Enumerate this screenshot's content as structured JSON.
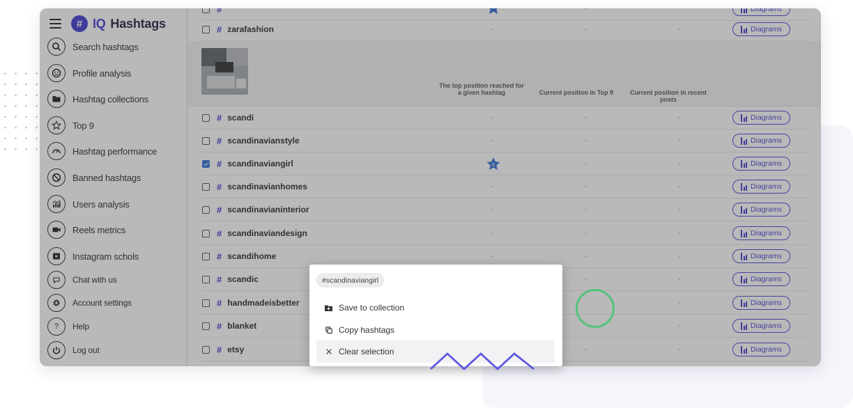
{
  "app": {
    "logo_mark": "#",
    "logo_brand": "IQ",
    "logo_name": "Hashtags"
  },
  "sidebar": {
    "items": [
      {
        "label": "Search hashtags",
        "icon": "search-icon"
      },
      {
        "label": "Profile analysis",
        "icon": "smiley-icon"
      },
      {
        "label": "Hashtag collections",
        "icon": "folder-icon"
      },
      {
        "label": "Top 9",
        "icon": "star-icon"
      },
      {
        "label": "Hashtag performance",
        "icon": "gauge-icon"
      },
      {
        "label": "Banned hashtags",
        "icon": "ban-icon"
      },
      {
        "label": "Users analysis",
        "icon": "chart-icon"
      },
      {
        "label": "Reels metrics",
        "icon": "video-icon"
      },
      {
        "label": "Instagram schols",
        "icon": "play-square-icon"
      },
      {
        "label": "Chat with us",
        "icon": "chat-icon"
      },
      {
        "label": "Account settings",
        "icon": "gear-icon"
      },
      {
        "label": "Help",
        "icon": "question-icon"
      },
      {
        "label": "Log out",
        "icon": "power-icon"
      }
    ]
  },
  "table": {
    "headers": {
      "top_position": "The top position reached for a given hashtag",
      "current_top9": "Current position in Top 9",
      "recent_posts": "Current position in recent posts"
    },
    "diagram_label": "Diagrams",
    "dash": "-",
    "top_rows": [
      {
        "tag": "zarafashion",
        "checked": false
      }
    ],
    "rows": [
      {
        "tag": "scandi",
        "checked": false
      },
      {
        "tag": "scandinavianstyle",
        "checked": false
      },
      {
        "tag": "scandinaviangirl",
        "checked": true,
        "top_position": "6"
      },
      {
        "tag": "scandinavianhomes",
        "checked": false
      },
      {
        "tag": "scandinavianinterior",
        "checked": false
      },
      {
        "tag": "scandinaviandesign",
        "checked": false
      },
      {
        "tag": "scandihome",
        "checked": false
      },
      {
        "tag": "scandic",
        "checked": false
      },
      {
        "tag": "handmadeisbetter",
        "checked": false
      },
      {
        "tag": "blanket",
        "checked": false
      },
      {
        "tag": "etsy",
        "checked": false
      }
    ]
  },
  "popup": {
    "chip": "#scandinaviangirl",
    "items": [
      {
        "label": "Save to collection",
        "icon": "folder-plus-icon"
      },
      {
        "label": "Copy hashtags",
        "icon": "copy-icon"
      },
      {
        "label": "Clear selection",
        "icon": "close-icon"
      }
    ]
  },
  "colors": {
    "accent": "#3f3bd0",
    "checkbox": "#2f6fd6",
    "highlight_circle": "#52c27c"
  }
}
